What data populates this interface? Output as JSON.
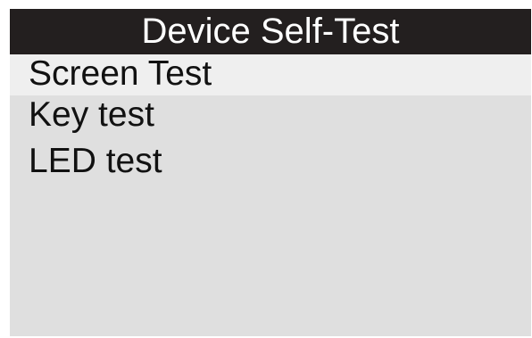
{
  "header": {
    "title": "Device Self-Test"
  },
  "menu": {
    "items": [
      {
        "label": "Screen Test",
        "selected": true
      },
      {
        "label": "Key test",
        "selected": false
      },
      {
        "label": "LED test",
        "selected": false
      }
    ]
  },
  "colors": {
    "title_bar_bg": "#231f1f",
    "title_text": "#ffffff",
    "screen_bg": "#dfdfdf",
    "selected_row_bg": "#efefef",
    "item_text": "#111111"
  }
}
